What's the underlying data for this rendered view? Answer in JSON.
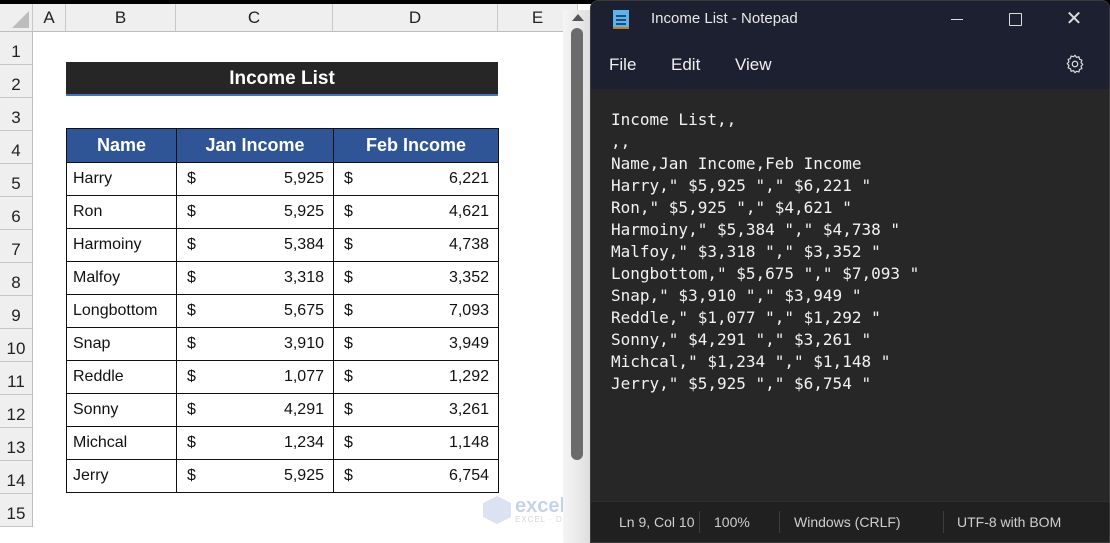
{
  "excel": {
    "columns": [
      "A",
      "B",
      "C",
      "D",
      "E"
    ],
    "rows": [
      "1",
      "2",
      "3",
      "4",
      "5",
      "6",
      "7",
      "8",
      "9",
      "10",
      "11",
      "12",
      "13",
      "14",
      "15"
    ],
    "title": "Income List",
    "table": {
      "headers": [
        "Name",
        "Jan Income",
        "Feb Income"
      ],
      "currency_symbol": "$",
      "rows": [
        {
          "name": "Harry",
          "jan": "5,925",
          "feb": "6,221"
        },
        {
          "name": "Ron",
          "jan": "5,925",
          "feb": "4,621"
        },
        {
          "name": "Harmoiny",
          "jan": "5,384",
          "feb": "4,738"
        },
        {
          "name": "Malfoy",
          "jan": "3,318",
          "feb": "3,352"
        },
        {
          "name": "Longbottom",
          "jan": "5,675",
          "feb": "7,093"
        },
        {
          "name": "Snap",
          "jan": "3,910",
          "feb": "3,949"
        },
        {
          "name": "Reddle",
          "jan": "1,077",
          "feb": "1,292"
        },
        {
          "name": "Sonny",
          "jan": "4,291",
          "feb": "3,261"
        },
        {
          "name": "Michcal",
          "jan": "1,234",
          "feb": "1,148"
        },
        {
          "name": "Jerry",
          "jan": "5,925",
          "feb": "6,754"
        }
      ]
    },
    "colors": {
      "title_bg": "#262626",
      "header_bg": "#2f5597"
    }
  },
  "watermark": {
    "text": "exceldemy",
    "sub": "EXCEL · DATA · BI"
  },
  "notepad": {
    "title": "Income List - Notepad",
    "menu": [
      "File",
      "Edit",
      "View"
    ],
    "lines": [
      "Income List,,",
      ",,",
      "Name,Jan Income,Feb Income",
      "Harry,\" $5,925 \",\" $6,221 \"",
      "Ron,\" $5,925 \",\" $4,621 \"",
      "Harmoiny,\" $5,384 \",\" $4,738 \"",
      "Malfoy,\" $3,318 \",\" $3,352 \"",
      "Longbottom,\" $5,675 \",\" $7,093 \"",
      "Snap,\" $3,910 \",\" $3,949 \"",
      "Reddle,\" $1,077 \",\" $1,292 \"",
      "Sonny,\" $4,291 \",\" $3,261 \"",
      "Michcal,\" $1,234 \",\" $1,148 \"",
      "Jerry,\" $5,925 \",\" $6,754 \""
    ],
    "status": {
      "position": "Ln 9, Col 10",
      "zoom": "100%",
      "line_ending": "Windows (CRLF)",
      "encoding": "UTF-8 with BOM"
    },
    "icons": {
      "app": "notepad-icon",
      "settings": "gear-icon"
    }
  }
}
